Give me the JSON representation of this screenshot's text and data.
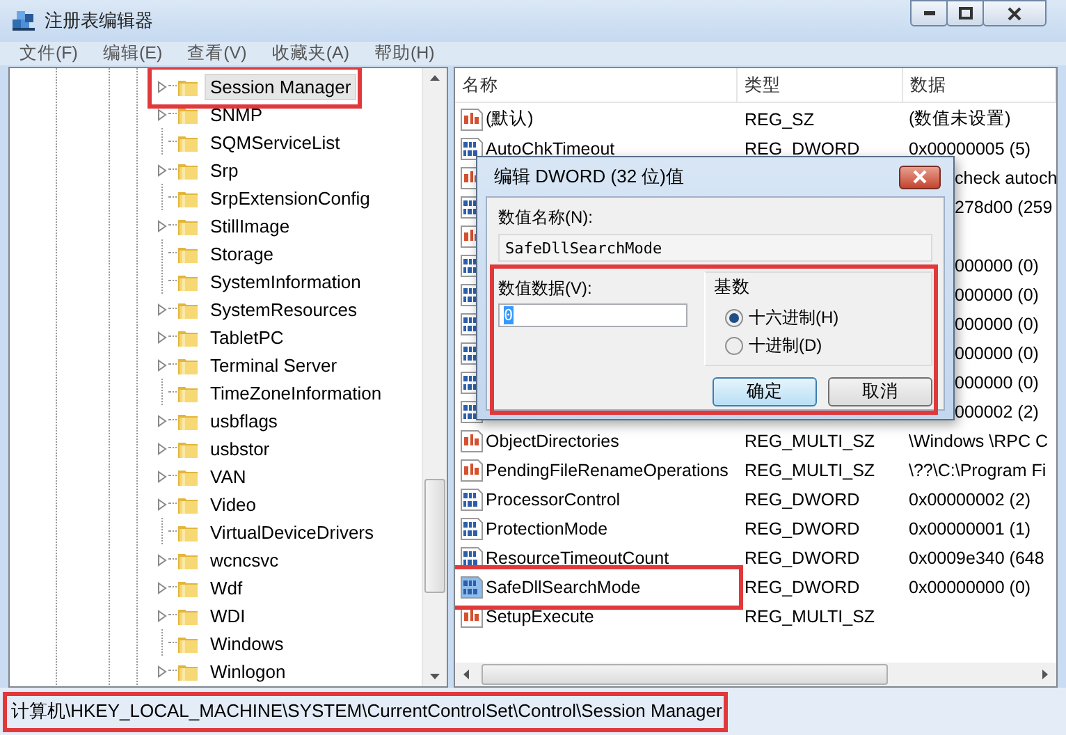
{
  "window": {
    "title": "注册表编辑器"
  },
  "menu": [
    "文件(F)",
    "编辑(E)",
    "查看(V)",
    "收藏夹(A)",
    "帮助(H)"
  ],
  "tree": {
    "items": [
      {
        "label": "Session Manager",
        "expandable": true,
        "selected": true,
        "annotated": true
      },
      {
        "label": "SNMP",
        "expandable": true,
        "selected": false
      },
      {
        "label": "SQMServiceList",
        "expandable": false,
        "selected": false
      },
      {
        "label": "Srp",
        "expandable": true,
        "selected": false
      },
      {
        "label": "SrpExtensionConfig",
        "expandable": false,
        "selected": false
      },
      {
        "label": "StillImage",
        "expandable": true,
        "selected": false
      },
      {
        "label": "Storage",
        "expandable": false,
        "selected": false
      },
      {
        "label": "SystemInformation",
        "expandable": false,
        "selected": false
      },
      {
        "label": "SystemResources",
        "expandable": true,
        "selected": false
      },
      {
        "label": "TabletPC",
        "expandable": true,
        "selected": false
      },
      {
        "label": "Terminal Server",
        "expandable": true,
        "selected": false
      },
      {
        "label": "TimeZoneInformation",
        "expandable": false,
        "selected": false
      },
      {
        "label": "usbflags",
        "expandable": true,
        "selected": false
      },
      {
        "label": "usbstor",
        "expandable": true,
        "selected": false
      },
      {
        "label": "VAN",
        "expandable": true,
        "selected": false
      },
      {
        "label": "Video",
        "expandable": true,
        "selected": false
      },
      {
        "label": "VirtualDeviceDrivers",
        "expandable": false,
        "selected": false
      },
      {
        "label": "wcncsvc",
        "expandable": true,
        "selected": false
      },
      {
        "label": "Wdf",
        "expandable": true,
        "selected": false
      },
      {
        "label": "WDI",
        "expandable": true,
        "selected": false
      },
      {
        "label": "Windows",
        "expandable": false,
        "selected": false
      },
      {
        "label": "Winlogon",
        "expandable": true,
        "selected": false
      }
    ]
  },
  "values": {
    "columns": [
      "名称",
      "类型",
      "数据"
    ],
    "rows": [
      {
        "kind": "string",
        "name": "(默认)",
        "type": "REG_SZ",
        "data": "(数值未设置)",
        "selected": false
      },
      {
        "kind": "dword",
        "name": "AutoChkTimeout",
        "type": "REG_DWORD",
        "data": "0x00000005 (5)",
        "selected": false
      },
      {
        "kind": "string",
        "data": "check autoch"
      },
      {
        "kind": "dword",
        "data": "278d00 (259"
      },
      {
        "kind": "string"
      },
      {
        "kind": "dword",
        "data": "000000 (0)"
      },
      {
        "kind": "dword",
        "data": "000000 (0)"
      },
      {
        "kind": "dword",
        "data": "000000 (0)"
      },
      {
        "kind": "dword",
        "data": "000000 (0)"
      },
      {
        "kind": "dword",
        "data": "000000 (0)"
      },
      {
        "kind": "dword",
        "data": "000002 (2)"
      },
      {
        "kind": "string",
        "name": "ObjectDirectories",
        "type": "REG_MULTI_SZ",
        "data": "\\Windows \\RPC C",
        "selected": false
      },
      {
        "kind": "string",
        "name": "PendingFileRenameOperations",
        "type": "REG_MULTI_SZ",
        "data": "\\??\\C:\\Program Fi",
        "selected": false
      },
      {
        "kind": "dword",
        "name": "ProcessorControl",
        "type": "REG_DWORD",
        "data": "0x00000002 (2)",
        "selected": false
      },
      {
        "kind": "dword",
        "name": "ProtectionMode",
        "type": "REG_DWORD",
        "data": "0x00000001 (1)",
        "selected": false
      },
      {
        "kind": "dword",
        "name": "ResourceTimeoutCount",
        "type": "REG_DWORD",
        "data": "0x0009e340 (648",
        "selected": false
      },
      {
        "kind": "dword",
        "name": "SafeDllSearchMode",
        "type": "REG_DWORD",
        "data": "0x00000000 (0)",
        "selected": true,
        "annotated": true
      },
      {
        "kind": "string",
        "name": "SetupExecute",
        "type": "REG_MULTI_SZ",
        "selected": false
      }
    ]
  },
  "dialog": {
    "title": "编辑 DWORD (32 位)值",
    "name_label": "数值名称(N):",
    "name_value": "SafeDllSearchMode",
    "data_label": "数值数据(V):",
    "data_value": "0",
    "base_label": "基数",
    "annotated": true,
    "bases": [
      {
        "label": "十六进制(H)",
        "selected": true
      },
      {
        "label": "十进制(D)",
        "selected": false
      }
    ],
    "buttons": [
      {
        "label": "确定",
        "default": true
      },
      {
        "label": "取消",
        "default": false
      }
    ]
  },
  "status_bar": {
    "path": "计算机\\HKEY_LOCAL_MACHINE\\SYSTEM\\CurrentControlSet\\Control\\Session Manager",
    "annotated": true
  }
}
